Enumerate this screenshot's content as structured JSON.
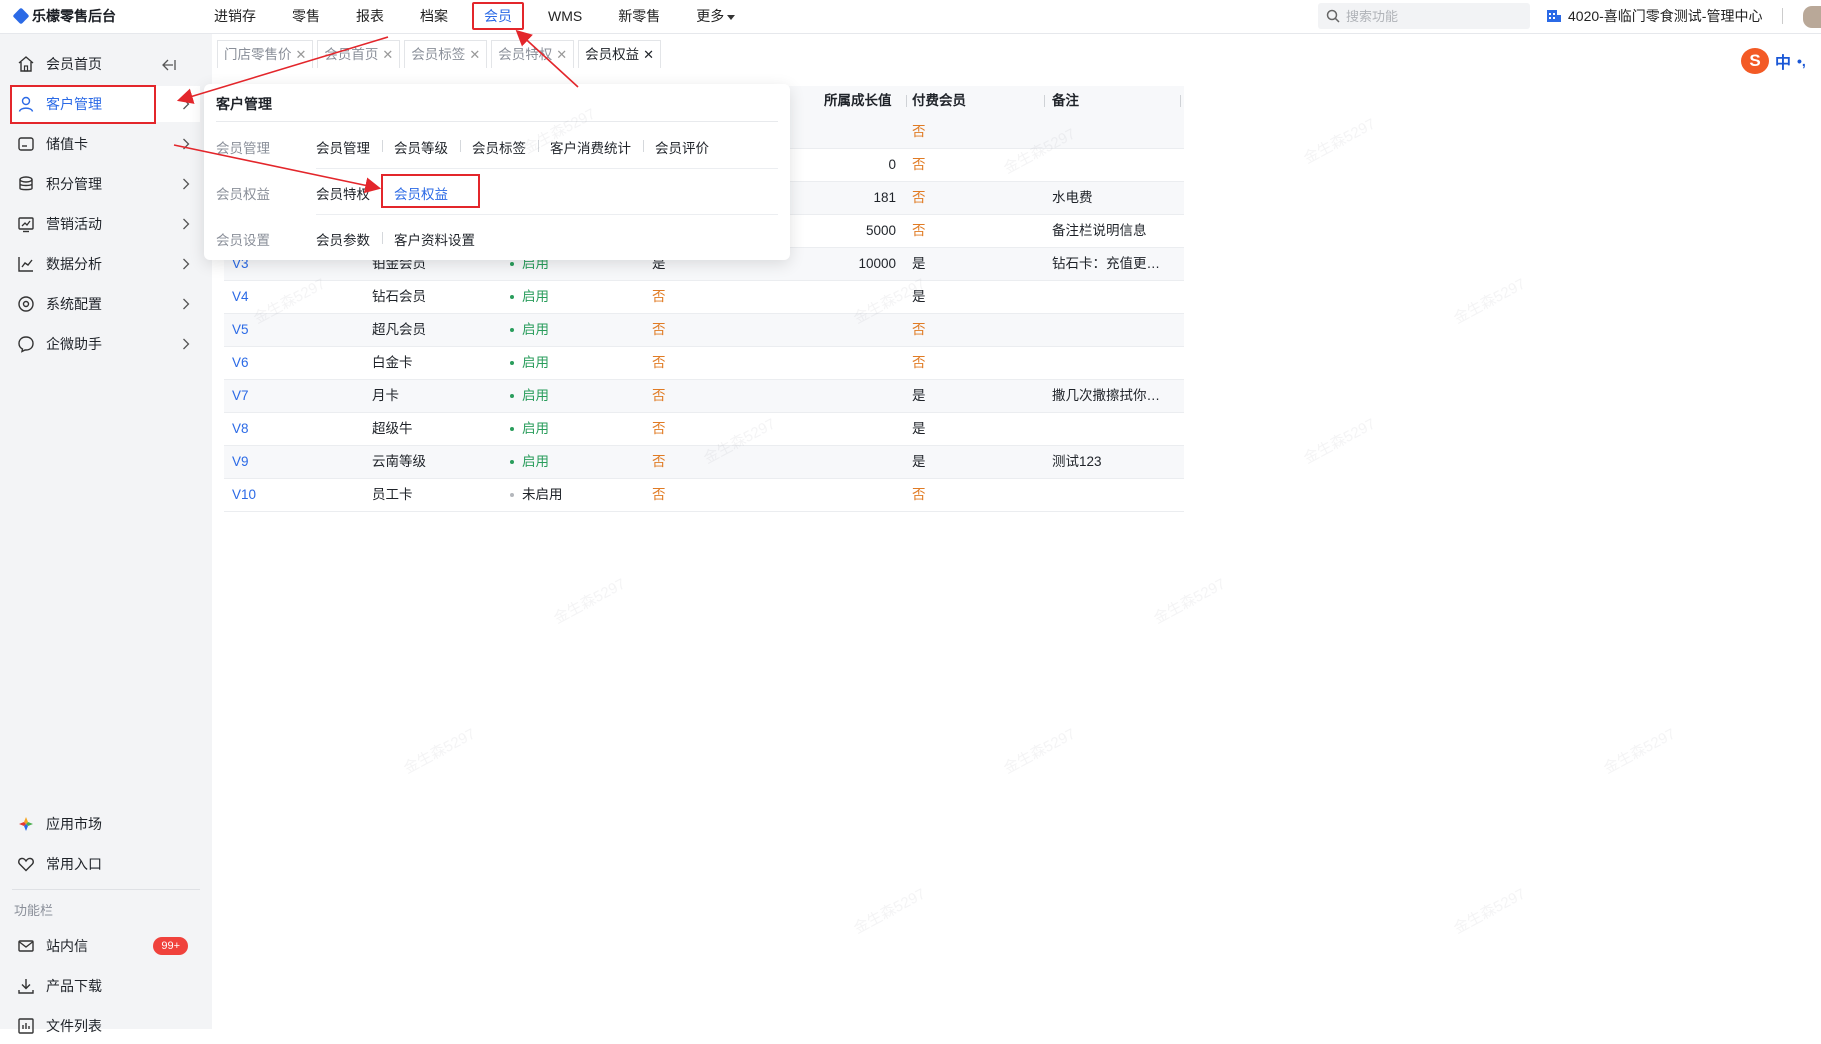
{
  "brand": {
    "title": "乐檬零售后台"
  },
  "topnav": {
    "items": [
      {
        "label": "进销存"
      },
      {
        "label": "零售"
      },
      {
        "label": "报表"
      },
      {
        "label": "档案"
      },
      {
        "label": "会员",
        "active": true
      },
      {
        "label": "WMS"
      },
      {
        "label": "新零售"
      },
      {
        "label": "更多"
      }
    ]
  },
  "search": {
    "placeholder": "搜索功能"
  },
  "store": {
    "name": "4020-喜临门零食测试-管理中心"
  },
  "sidebar": {
    "items": [
      {
        "label": "会员首页",
        "icon": "home-icon"
      },
      {
        "label": "客户管理",
        "icon": "user-icon",
        "active": true
      },
      {
        "label": "储值卡",
        "icon": "card-icon"
      },
      {
        "label": "积分管理",
        "icon": "database-icon"
      },
      {
        "label": "营销活动",
        "icon": "chart-board-icon"
      },
      {
        "label": "数据分析",
        "icon": "line-chart-icon"
      },
      {
        "label": "系统配置",
        "icon": "settings-icon"
      },
      {
        "label": "企微助手",
        "icon": "chat-icon"
      }
    ],
    "bottom": [
      {
        "label": "应用市场",
        "icon": "app-market-icon"
      },
      {
        "label": "常用入口",
        "icon": "heart-icon"
      }
    ],
    "caption": "功能栏",
    "tools": [
      {
        "label": "站内信",
        "icon": "mail-icon",
        "badge": "99+"
      },
      {
        "label": "产品下载",
        "icon": "download-icon"
      },
      {
        "label": "文件列表",
        "icon": "file-list-icon"
      }
    ]
  },
  "tabs": [
    {
      "label": "门店零售价"
    },
    {
      "label": "会员首页"
    },
    {
      "label": "会员标签"
    },
    {
      "label": "会员特权"
    },
    {
      "label": "会员权益",
      "active": true
    }
  ],
  "ime": {
    "logo": "S",
    "mode": "中",
    "punct": "•,"
  },
  "table": {
    "headers": {
      "growth": "所属成长值",
      "paid": "付费会员",
      "note": "备注"
    },
    "rows": [
      {
        "code": "",
        "name": "",
        "status": "",
        "flag": "",
        "growth": "",
        "paid": "否",
        "note": ""
      },
      {
        "code": "",
        "name": "",
        "status": "",
        "flag": "",
        "growth": "0",
        "paid": "否",
        "note": ""
      },
      {
        "code": "",
        "name": "",
        "status": "",
        "flag": "",
        "growth": "181",
        "paid": "否",
        "note": "水电费"
      },
      {
        "code": "",
        "name": "",
        "status": "",
        "flag": "",
        "growth": "5000",
        "paid": "否",
        "note": "备注栏说明信息"
      },
      {
        "code": "V3",
        "name": "铂金会员",
        "status": "启用",
        "flag": "是",
        "growth": "10000",
        "paid": "是",
        "note": "钻石卡：充值更…"
      },
      {
        "code": "V4",
        "name": "钻石会员",
        "status": "启用",
        "flag": "否",
        "growth": "",
        "paid": "是",
        "note": ""
      },
      {
        "code": "V5",
        "name": "超凡会员",
        "status": "启用",
        "flag": "否",
        "growth": "",
        "paid": "否",
        "note": ""
      },
      {
        "code": "V6",
        "name": "白金卡",
        "status": "启用",
        "flag": "否",
        "growth": "",
        "paid": "否",
        "note": ""
      },
      {
        "code": "V7",
        "name": "月卡",
        "status": "启用",
        "flag": "否",
        "growth": "",
        "paid": "是",
        "note": "撒几次撒擦拭你…"
      },
      {
        "code": "V8",
        "name": "超级牛",
        "status": "启用",
        "flag": "否",
        "growth": "",
        "paid": "是",
        "note": ""
      },
      {
        "code": "V9",
        "name": "云南等级",
        "status": "启用",
        "flag": "否",
        "growth": "",
        "paid": "是",
        "note": "测试123"
      },
      {
        "code": "V10",
        "name": "员工卡",
        "status": "未启用",
        "flag": "否",
        "growth": "",
        "paid": "否",
        "note": ""
      }
    ]
  },
  "dropdown": {
    "title": "客户管理",
    "groups": [
      {
        "category": "会员管理",
        "links": [
          "会员管理",
          "会员等级",
          "会员标签",
          "客户消费统计",
          "会员评价"
        ]
      },
      {
        "category": "会员权益",
        "links": [
          "会员特权",
          "会员权益"
        ],
        "selected": "会员权益"
      },
      {
        "category": "会员设置",
        "links": [
          "会员参数",
          "客户资料设置"
        ]
      }
    ]
  },
  "colors": {
    "accent": "#2b6ae6",
    "annotation": "#e3262b",
    "enabled": "#2a9d5c",
    "no": "#e07b24",
    "badge": "#f0423c"
  },
  "watermark": "金生森5297"
}
